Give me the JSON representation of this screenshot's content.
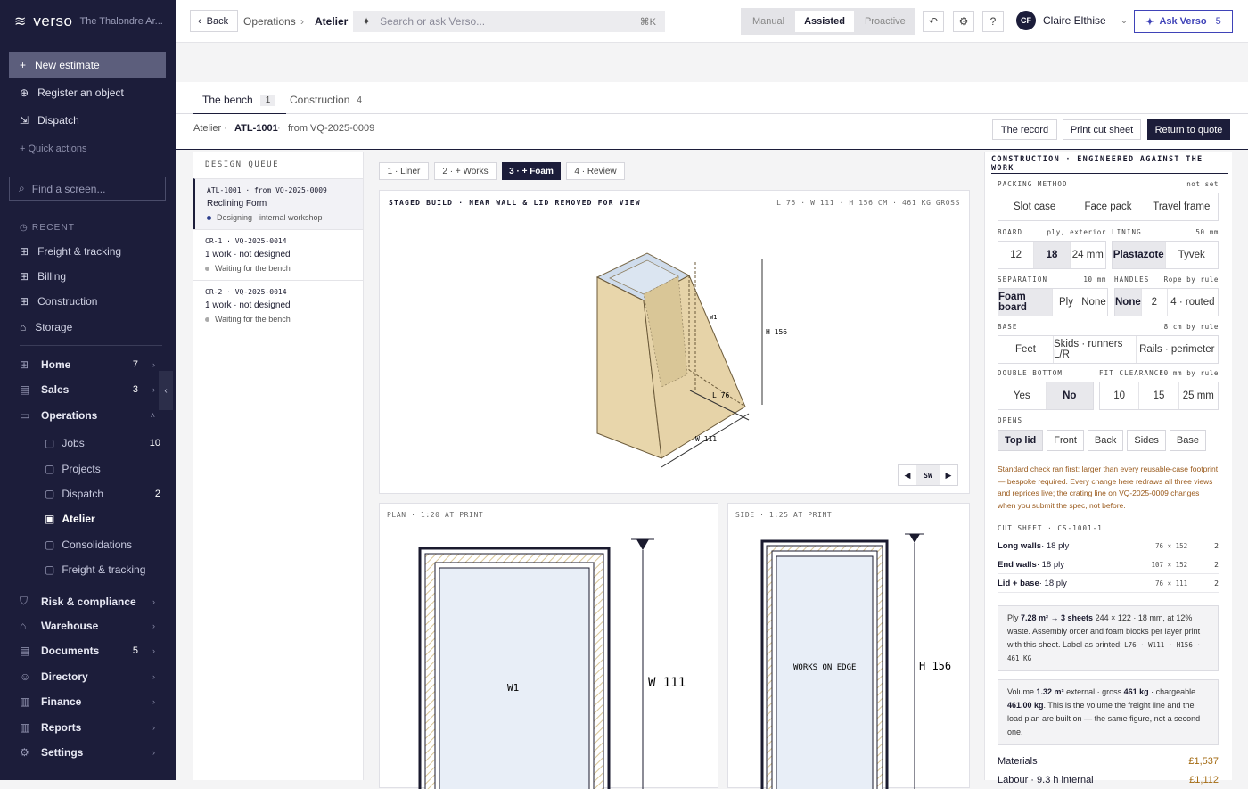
{
  "brand": {
    "logo": "verso",
    "org": "The Thalondre Ar..."
  },
  "sidebar": {
    "new_estimate": "New estimate",
    "register": "Register an object",
    "dispatch": "Dispatch",
    "quick": "Quick actions",
    "find": "Find a screen...",
    "recent_label": "RECENT",
    "recent": [
      "Freight & tracking",
      "Billing",
      "Construction",
      "Storage"
    ],
    "nav": [
      {
        "label": "Home",
        "count": "7"
      },
      {
        "label": "Sales",
        "count": "3"
      },
      {
        "label": "Operations",
        "count": ""
      }
    ],
    "ops": [
      {
        "label": "Jobs",
        "count": "10"
      },
      {
        "label": "Projects",
        "count": ""
      },
      {
        "label": "Dispatch",
        "count": "2"
      },
      {
        "label": "Atelier",
        "count": ""
      },
      {
        "label": "Consolidations",
        "count": ""
      },
      {
        "label": "Freight & tracking",
        "count": ""
      }
    ],
    "nav2": [
      {
        "label": "Risk & compliance",
        "count": ""
      },
      {
        "label": "Warehouse",
        "count": ""
      },
      {
        "label": "Documents",
        "count": "5"
      },
      {
        "label": "Directory",
        "count": ""
      },
      {
        "label": "Finance",
        "count": ""
      },
      {
        "label": "Reports",
        "count": ""
      },
      {
        "label": "Settings",
        "count": ""
      }
    ]
  },
  "topbar": {
    "back": "Back",
    "crumb1": "Operations",
    "crumb2": "Atelier",
    "search_placeholder": "Search or ask Verso...",
    "kbd": "⌘K",
    "modes": [
      "Manual",
      "Assisted",
      "Proactive"
    ],
    "user": "Claire Elthise",
    "initials": "CF",
    "ask": "Ask Verso",
    "ask_count": "5"
  },
  "tabs": [
    {
      "label": "The bench",
      "count": "1"
    },
    {
      "label": "Construction",
      "count": "4"
    }
  ],
  "record": {
    "crumb1": "Atelier",
    "id": "ATL-1001",
    "from": "from VQ-2025-0009",
    "btn_record": "The record",
    "btn_print": "Print cut sheet",
    "btn_return": "Return to quote"
  },
  "queue": {
    "title": "DESIGN QUEUE",
    "items": [
      {
        "id": "ATL-1001 · from VQ-2025-0009",
        "title": "Reclining Form",
        "status": "Designing · internal workshop",
        "color": "#2c3e8c"
      },
      {
        "id": "CR-1 · VQ-2025-0014",
        "title": "1 work · not designed",
        "status": "Waiting for the bench",
        "color": "#aaaaaa"
      },
      {
        "id": "CR-2 · VQ-2025-0014",
        "title": "1 work · not designed",
        "status": "Waiting for the bench",
        "color": "#aaaaaa"
      }
    ]
  },
  "steps": [
    "1 · Liner",
    "2 · + Works",
    "3 · + Foam",
    "4 · Review"
  ],
  "iso": {
    "title": "STAGED BUILD · NEAR WALL & LID REMOVED FOR VIEW",
    "meta": "L 76 · W 111 · H 156 CM · 461 KG GROSS",
    "w1": "W1",
    "h": "H 156",
    "l": "L 76",
    "w": "W 111",
    "view": "SW"
  },
  "plan": {
    "title": "PLAN · 1:20 AT PRINT",
    "inner": "W1",
    "dim": "W 111"
  },
  "side": {
    "title": "SIDE · 1:25 AT PRINT",
    "inner": "WORKS ON EDGE",
    "dim": "H 156"
  },
  "right": {
    "title": "CONSTRUCTION · ENGINEERED AGAINST THE WORK",
    "packing_label": "PACKING METHOD",
    "packing_state": "not set",
    "packing": [
      "Slot case",
      "Face pack",
      "Travel frame"
    ],
    "board_label": "BOARD",
    "board_note": "ply, exterior",
    "board": [
      "12",
      "18",
      "24 mm"
    ],
    "lining_label": "LINING",
    "lining_note": "50 mm",
    "lining": [
      "Plastazote",
      "Tyvek"
    ],
    "sep_label": "SEPARATION",
    "sep_note": "10 mm",
    "sep": [
      "Foam board",
      "Ply",
      "None"
    ],
    "handles_label": "HANDLES",
    "handles_note": "Rope by rule",
    "handles": [
      "None",
      "2",
      "4 · routed"
    ],
    "base_label": "BASE",
    "base_note": "8 cm by rule",
    "base": [
      "Feet",
      "Skids · runners L/R",
      "Rails · perimeter"
    ],
    "dbl_label": "DOUBLE BOTTOM",
    "dbl": [
      "Yes",
      "No"
    ],
    "fit_label": "FIT CLEARANCE",
    "fit_note": "40 mm by rule",
    "fit": [
      "10",
      "15",
      "25 mm"
    ],
    "opens_label": "OPENS",
    "opens": [
      "Top lid",
      "Front",
      "Back",
      "Sides",
      "Base"
    ],
    "warning": "Standard check ran first: larger than every reusable-case footprint — bespoke required. Every change here redraws all three views and reprices live; the crating line on VQ-2025-0009 changes when you submit the spec, not before.",
    "cut_label": "CUT SHEET · CS-1001-1",
    "cuts": [
      {
        "name": "Long walls",
        "mat": " · 18 ply",
        "dim": "76 × 152",
        "q": "2"
      },
      {
        "name": "End walls",
        "mat": " · 18 ply",
        "dim": "107 × 152",
        "q": "2"
      },
      {
        "name": "Lid + base",
        "mat": " · 18 ply",
        "dim": "76 × 111",
        "q": "2"
      }
    ],
    "ply_note_a": "Ply ",
    "ply_note_b": "7.28 m² → 3 sheets",
    "ply_note_c": " 244 × 122 · 18 mm, at 12% waste. Assembly order and foam blocks per layer print with this sheet. Label as printed: ",
    "ply_note_d": "L76 · W111 · H156 · 461 KG",
    "vol_a": "Volume ",
    "vol_b": "1.32 m³",
    "vol_c": " external · gross ",
    "vol_d": "461 kg",
    "vol_e": " · chargeable ",
    "vol_f": "461.00 kg",
    "vol_g": ". This is the volume the freight line and the load plan are built on — the same figure, not a second one.",
    "materials": "Materials",
    "materials_v": "£1,537",
    "labour": "Labour · 9.3 h internal",
    "labour_v": "£1,112"
  },
  "colors": {
    "sidebar": "#1c1d3a",
    "accent": "#3f43b8",
    "wood": "#e8d6ab",
    "warn": "#9a5a1c"
  }
}
